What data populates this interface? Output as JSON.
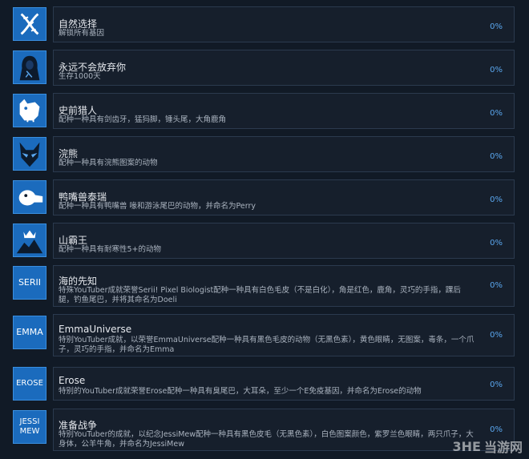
{
  "achievements": [
    {
      "icon": "dna-icon",
      "title": "自然选择",
      "desc": "解锁所有基因",
      "percent": "0%"
    },
    {
      "icon": "hooded-figure-icon",
      "title": "永远不会放弃你",
      "desc": "生存1000天",
      "percent": "0%"
    },
    {
      "icon": "sabertooth-icon",
      "title": "史前猎人",
      "desc": "配种一种具有剑齿牙，猛犸脚，锤头尾，大角鹿角",
      "percent": "0%"
    },
    {
      "icon": "raccoon-icon",
      "title": "浣熊",
      "desc": "配种一种具有浣熊图案的动物",
      "percent": "0%"
    },
    {
      "icon": "platypus-icon",
      "title": "鸭嘴兽泰瑞",
      "desc": "配种一种具有鸭嘴兽 喙和游泳尾巴的动物，并命名为Perry",
      "percent": "0%"
    },
    {
      "icon": "mountain-crown-icon",
      "title": "山霸王",
      "desc": "配种一种具有耐寒性5+的动物",
      "percent": "0%"
    },
    {
      "icon": "serii-badge-icon",
      "icon_text": "SERII",
      "title": "海的先知",
      "desc": "特殊YouTuber成就荣誉Serii! Pixel Biologist配种一种具有白色毛皮（不是白化），角是红色，鹿角，灵巧的手指，踝后腿，钓鱼尾巴，并将其命名为Doeli",
      "percent": "0%"
    },
    {
      "icon": "emma-badge-icon",
      "icon_text": "EMMA",
      "title": "EmmaUniverse",
      "desc": "特别YouTuber成就，以荣誉EmmaUniverse配种一种具有黑色毛皮的动物（无黑色素），黄色眼睛，无图案，毒条，一个爪子，灵巧的手指，并命名为Emma",
      "percent": "0%"
    },
    {
      "icon": "erose-badge-icon",
      "icon_text": "EROSE",
      "title": "Erose",
      "desc": "特别的YouTuber成就荣誉Erose配种一种具有臭尾巴，大耳朵，至少一个E免疫基因，并命名为Erose的动物",
      "percent": "0%"
    },
    {
      "icon": "jessimew-badge-icon",
      "icon_text": "JESSI MEW",
      "title": "准备战争",
      "desc": "特别YouTuber的成就，以纪念JessiMew配种一种具有黑色皮毛（无黑色素），白色图案颜色，紫罗兰色眼睛，两只爪子，大身体，公羊牛角，并命名为JessiMew",
      "percent": "0%"
    }
  ],
  "watermark": {
    "brand": "3HE",
    "site": "当游网"
  }
}
